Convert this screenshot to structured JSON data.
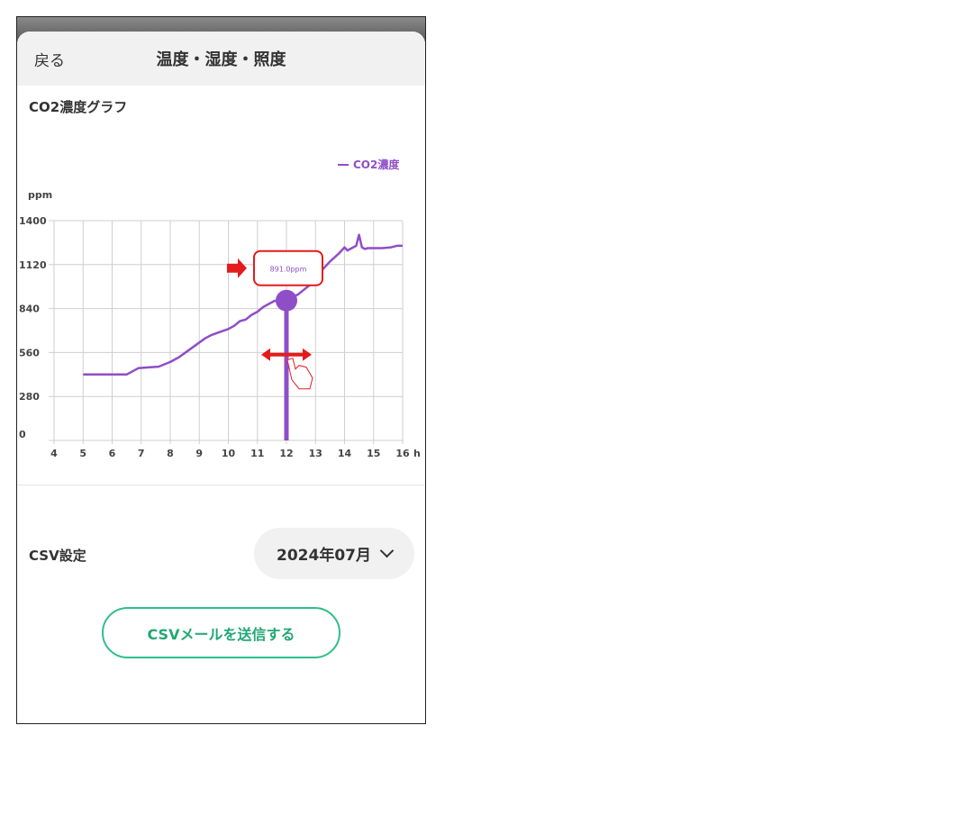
{
  "nav": {
    "back_label": "戻る",
    "title": "温度・湿度・照度"
  },
  "chart_section": {
    "title": "CO2濃度グラフ"
  },
  "csv": {
    "label": "CSV設定",
    "month": "2024年07月",
    "send_label": "CSVメールを送信する"
  },
  "colors": {
    "series": "#8f4ec7",
    "accent_green": "#2fbf8a",
    "annotation_red": "#e41b1b"
  },
  "chart_data": {
    "type": "line",
    "ylabel": "ppm",
    "x_unit": "h",
    "xlim": [
      4,
      16
    ],
    "ylim": [
      0,
      1400
    ],
    "x_ticks": [
      "4",
      "5",
      "6",
      "7",
      "8",
      "9",
      "10",
      "11",
      "12",
      "13",
      "14",
      "15",
      "16"
    ],
    "y_ticks": [
      "0",
      "280",
      "560",
      "840",
      "1120",
      "1400"
    ],
    "legend": {
      "position": "top-right",
      "label": "CO2濃度"
    },
    "grid": true,
    "series": [
      {
        "name": "CO2濃度",
        "x": [
          5.0,
          5.5,
          6.0,
          6.5,
          6.7,
          6.9,
          7.2,
          7.6,
          8.0,
          8.3,
          8.6,
          8.9,
          9.2,
          9.4,
          9.7,
          10.0,
          10.2,
          10.4,
          10.6,
          10.8,
          11.0,
          11.2,
          11.4,
          11.6,
          11.8,
          12.0,
          12.2,
          12.4,
          12.6,
          12.8,
          13.0,
          13.2,
          13.5,
          13.8,
          14.0,
          14.1,
          14.2,
          14.4,
          14.5,
          14.6,
          14.7,
          14.8,
          15.0,
          15.3,
          15.6,
          15.8,
          16.0
        ],
        "y": [
          420,
          420,
          420,
          420,
          440,
          460,
          465,
          470,
          500,
          530,
          570,
          610,
          650,
          670,
          690,
          710,
          730,
          760,
          770,
          800,
          820,
          850,
          870,
          890,
          880,
          891,
          910,
          930,
          960,
          990,
          1030,
          1080,
          1140,
          1190,
          1230,
          1210,
          1220,
          1240,
          1310,
          1230,
          1220,
          1225,
          1225,
          1225,
          1230,
          1240,
          1240
        ]
      }
    ],
    "selected_point": {
      "x": 12.0,
      "y": 891,
      "label": "891.0ppm"
    }
  }
}
